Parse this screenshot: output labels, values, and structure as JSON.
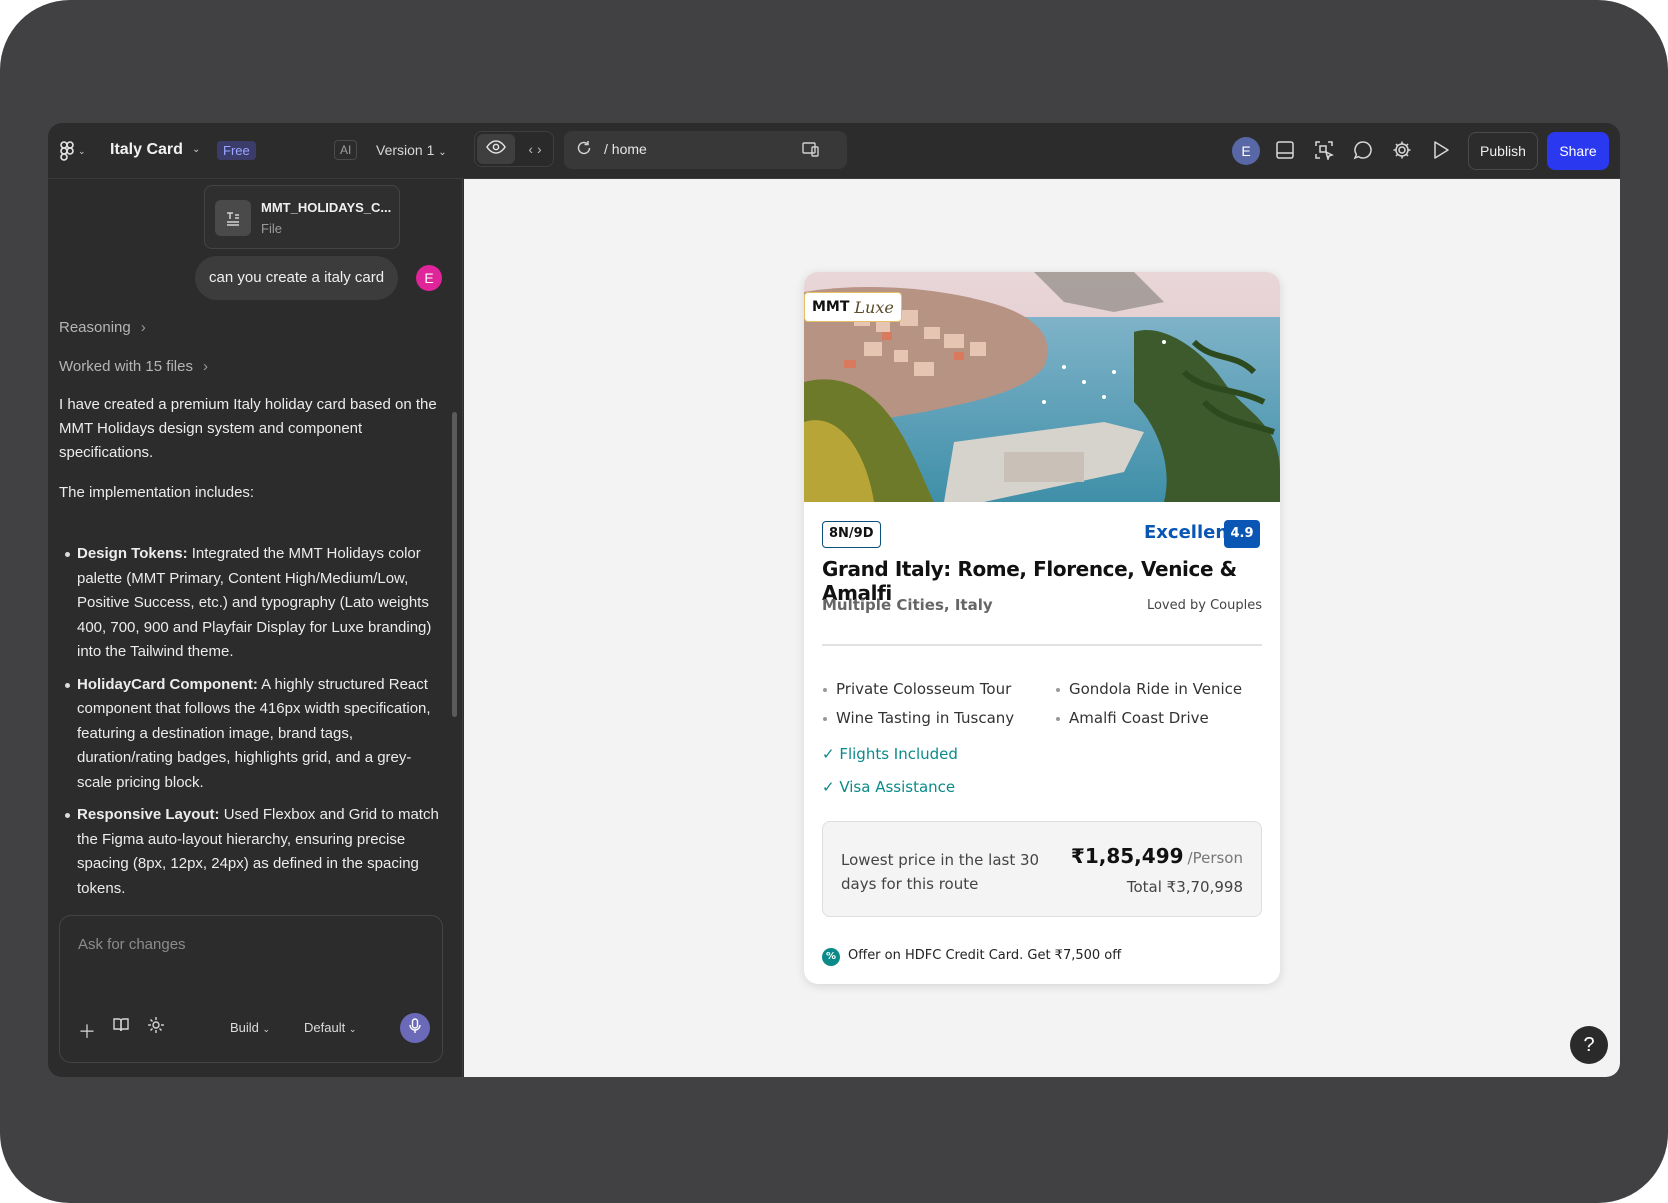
{
  "header": {
    "project_title": "Italy Card",
    "plan_badge": "Free",
    "ai_label": "AI",
    "version_label": "Version 1"
  },
  "chat": {
    "attachment": {
      "name": "MMT_HOLIDAYS_C...",
      "type": "File"
    },
    "user_message": "can you create a italy card",
    "user_avatar": "E",
    "reasoning_label": "Reasoning",
    "files_label": "Worked with 15 files",
    "response_intro": "I have created a premium Italy holiday card based on the MMT Holidays design system and component specifications.",
    "response_lead": "The implementation includes:",
    "bullets": [
      {
        "title": "Design Tokens:",
        "text": " Integrated the MMT Holidays color palette (MMT Primary, Content High/Medium/Low, Positive Success, etc.) and typography (Lato weights 400, 700, 900 and Playfair Display for Luxe branding) into the Tailwind theme."
      },
      {
        "title": "HolidayCard Component:",
        "text": " A highly structured React component that follows the 416px width specification, featuring a destination image, brand tags, duration/rating badges, highlights grid, and a grey-scale pricing block."
      },
      {
        "title": "Responsive Layout:",
        "text": " Used Flexbox and Grid to match the Figma auto-layout hierarchy, ensuring precise spacing (8px, 12px, 24px) as defined in the spacing tokens."
      }
    ],
    "composer_placeholder": "Ask for changes",
    "mode_label": "Build",
    "model_label": "Default"
  },
  "toolbar": {
    "url_path": "/ home",
    "avatar": "E",
    "publish_label": "Publish",
    "share_label": "Share"
  },
  "card": {
    "brand_mmt": "MMT",
    "brand_luxe": "Luxe",
    "duration": "8N/9D",
    "rating_text": "Excellent",
    "rating_value": "4.9",
    "title": "Grand Italy: Rome, Florence, Venice & Amalfi",
    "subtitle": "Multiple Cities, Italy",
    "tag": "Loved by Couples",
    "highlights": [
      "Private Colosseum Tour",
      "Gondola Ride in Venice",
      "Wine Tasting in Tuscany",
      "Amalfi Coast Drive"
    ],
    "inclusions": [
      "✓ Flights Included",
      "✓ Visa Assistance"
    ],
    "price_note": "Lowest price in the last 30 days for this route",
    "price_amount": "₹1,85,499",
    "price_unit": "/Person",
    "price_total": "Total ₹3,70,998",
    "offer_icon": "%",
    "offer_text": "Offer on HDFC Credit Card. Get ₹7,500 off"
  },
  "help_label": "?",
  "colors": {
    "accent_share": "#2a39f0",
    "rating_blue": "#0a56b5",
    "inclusion_teal": "#0b8a8a",
    "user_avatar": "#e0249a"
  }
}
